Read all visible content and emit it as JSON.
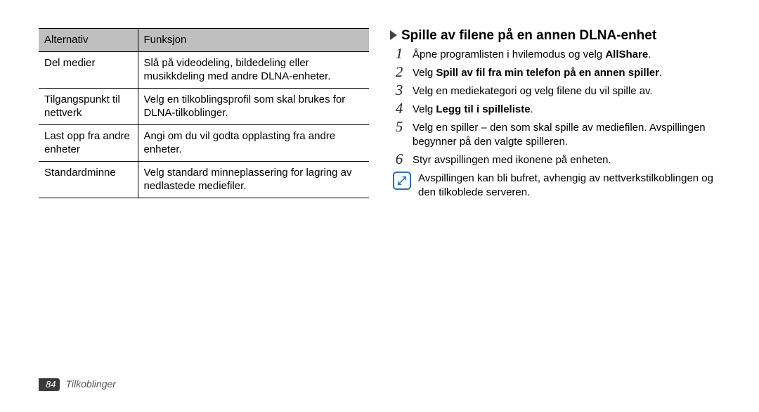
{
  "table": {
    "headers": {
      "c0": "Alternativ",
      "c1": "Funksjon"
    },
    "rows": [
      {
        "c0": "Del medier",
        "c1": "Slå på videodeling, bildedeling eller musikkdeling med andre DLNA-enheter."
      },
      {
        "c0": "Tilgangspunkt til nettverk",
        "c1": "Velg en tilkoblingsprofil som skal brukes for DLNA-tilkoblinger."
      },
      {
        "c0": "Last opp fra andre enheter",
        "c1": "Angi om du vil godta opplasting fra andre enheter."
      },
      {
        "c0": "Standardminne",
        "c1": "Velg standard minneplassering for lagring av nedlastede mediefiler."
      }
    ]
  },
  "section": {
    "title": "Spille av filene på en annen DLNA-enhet",
    "steps": {
      "n1": "1",
      "s1a": "Åpne programlisten i hvilemodus og velg ",
      "s1b": "AllShare",
      "s1c": ".",
      "n2": "2",
      "s2a": "Velg ",
      "s2b": "Spill av fil fra min telefon på en annen spiller",
      "s2c": ".",
      "n3": "3",
      "s3": "Velg en mediekategori og velg filene du vil spille av.",
      "n4": "4",
      "s4a": "Velg ",
      "s4b": "Legg til i spilleliste",
      "s4c": ".",
      "n5": "5",
      "s5": "Velg en spiller – den som skal spille av mediefilen. Avspillingen begynner på den valgte spilleren.",
      "n6": "6",
      "s6": "Styr avspillingen med ikonene på enheten."
    },
    "note": "Avspillingen kan bli bufret, avhengig av nettverkstilkoblingen og den tilkoblede serveren."
  },
  "footer": {
    "page": "84",
    "chapter": "Tilkoblinger"
  }
}
